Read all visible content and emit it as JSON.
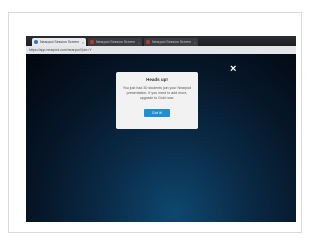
{
  "browser": {
    "tabs": [
      {
        "label": "Nearpod Session Screen",
        "favicon_color": "#2a7bc0"
      },
      {
        "label": "Nearpod Session Screen",
        "favicon_color": "#c0392b"
      },
      {
        "label": "Nearpod Session Screen",
        "favicon_color": "#c0392b"
      }
    ],
    "address": "https://app.nearpod.com/nearpod?pin=Y"
  },
  "modal": {
    "title": "Heads up!",
    "body": "You just had 30 students join your Nearpod presentation. If you need to add more, upgrade to Gold now.",
    "button_label": "Got it!"
  },
  "close_symbol": "×",
  "colors": {
    "button": "#1f8fd1",
    "modal_bg": "#f2f2f2"
  }
}
